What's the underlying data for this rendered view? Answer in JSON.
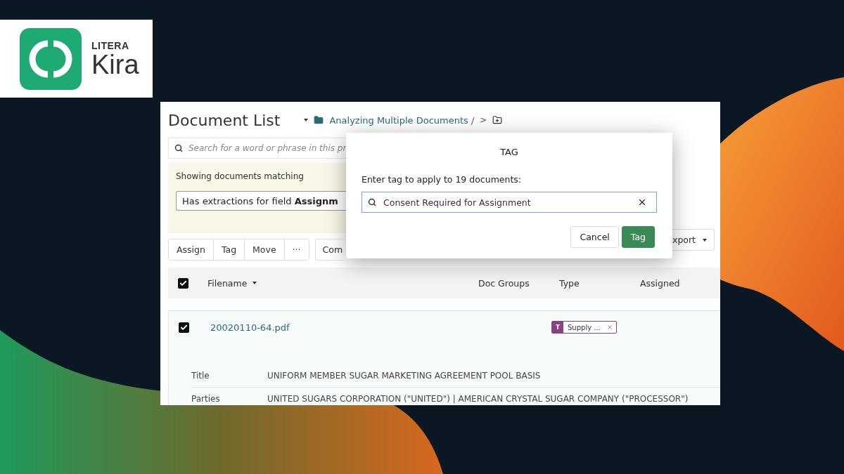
{
  "logo": {
    "brand": "LITERA",
    "product": "Kira"
  },
  "page": {
    "title": "Document List",
    "breadcrumb": "Analyzing Multiple Documents /",
    "separator": ">"
  },
  "search": {
    "placeholder": "Search for a word or phrase in this pr"
  },
  "filter": {
    "heading": "Showing documents matching",
    "condition": "Has extractions for field **Assignm**"
  },
  "toolbar": {
    "actions": [
      "Assign",
      "Tag",
      "Move",
      "···"
    ],
    "secondary": "Com",
    "export": "xport"
  },
  "table": {
    "all_checked": true,
    "columns": [
      "Filename",
      "Doc Groups",
      "Type",
      "Assigned"
    ],
    "rows": [
      {
        "checked": true,
        "filename": "20020110-64.pdf",
        "tag": {
          "letter": "T",
          "label": "Supply ..."
        },
        "fields": [
          {
            "label": "Title",
            "value": "UNIFORM MEMBER SUGAR MARKETING AGREEMENT POOL BASIS"
          },
          {
            "label": "Parties",
            "value": "UNITED SUGARS CORPORATION (\"UNITED\") | AMERICAN CRYSTAL SUGAR COMPANY (\"PROCESSOR\")"
          }
        ]
      }
    ]
  },
  "dialog": {
    "title": "TAG",
    "prompt": "Enter tag to apply to 19 documents:",
    "value": "Consent Required for Assignment",
    "buttons": [
      {
        "label": "Cancel",
        "kind": "secondary"
      },
      {
        "label": "Tag",
        "kind": "primary"
      }
    ]
  }
}
